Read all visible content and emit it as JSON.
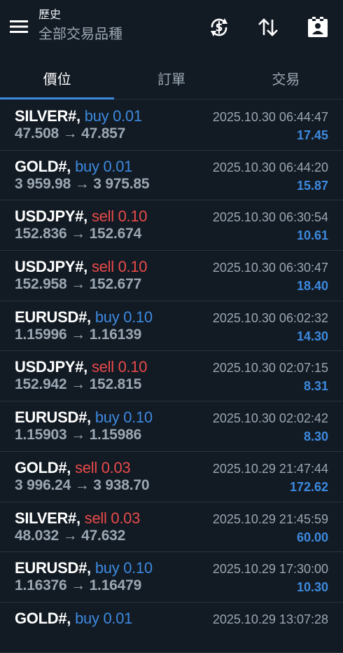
{
  "header": {
    "title": "歷史",
    "subtitle": "全部交易品種"
  },
  "icons": {
    "menu": "hamburger-menu-icon",
    "sync": "currency-sync-icon",
    "sort": "sort-arrows-icon",
    "report": "clipboard-report-icon"
  },
  "tabs": [
    {
      "label": "價位",
      "active": true
    },
    {
      "label": "訂單",
      "active": false
    },
    {
      "label": "交易",
      "active": false
    }
  ],
  "colors": {
    "background": "#121a23",
    "buy": "#3d8ae0",
    "sell": "#e84b4b",
    "profit": "#3d8ae0",
    "muted": "#9aa7b3"
  },
  "deals": [
    {
      "symbol": "SILVER#,",
      "side": "buy",
      "volume": "buy 0.01",
      "prices": "47.508 → 47.857",
      "date": "2025.10.30 06:44:47",
      "profit": "17.45"
    },
    {
      "symbol": "GOLD#,",
      "side": "buy",
      "volume": "buy 0.01",
      "prices": "3 959.98 → 3 975.85",
      "date": "2025.10.30 06:44:20",
      "profit": "15.87"
    },
    {
      "symbol": "USDJPY#,",
      "side": "sell",
      "volume": "sell 0.10",
      "prices": "152.836 → 152.674",
      "date": "2025.10.30 06:30:54",
      "profit": "10.61"
    },
    {
      "symbol": "USDJPY#,",
      "side": "sell",
      "volume": "sell 0.10",
      "prices": "152.958 → 152.677",
      "date": "2025.10.30 06:30:47",
      "profit": "18.40"
    },
    {
      "symbol": "EURUSD#,",
      "side": "buy",
      "volume": "buy 0.10",
      "prices": "1.15996 → 1.16139",
      "date": "2025.10.30 06:02:32",
      "profit": "14.30"
    },
    {
      "symbol": "USDJPY#,",
      "side": "sell",
      "volume": "sell 0.10",
      "prices": "152.942 → 152.815",
      "date": "2025.10.30 02:07:15",
      "profit": "8.31"
    },
    {
      "symbol": "EURUSD#,",
      "side": "buy",
      "volume": "buy 0.10",
      "prices": "1.15903 → 1.15986",
      "date": "2025.10.30 02:02:42",
      "profit": "8.30"
    },
    {
      "symbol": "GOLD#,",
      "side": "sell",
      "volume": "sell 0.03",
      "prices": "3 996.24 → 3 938.70",
      "date": "2025.10.29 21:47:44",
      "profit": "172.62"
    },
    {
      "symbol": "SILVER#,",
      "side": "sell",
      "volume": "sell 0.03",
      "prices": "48.032 → 47.632",
      "date": "2025.10.29 21:45:59",
      "profit": "60.00"
    },
    {
      "symbol": "EURUSD#,",
      "side": "buy",
      "volume": "buy 0.10",
      "prices": "1.16376 → 1.16479",
      "date": "2025.10.29 17:30:00",
      "profit": "10.30"
    },
    {
      "symbol": "GOLD#,",
      "side": "buy",
      "volume": "buy 0.01",
      "prices": "",
      "date": "2025.10.29 13:07:28",
      "profit": ""
    }
  ]
}
